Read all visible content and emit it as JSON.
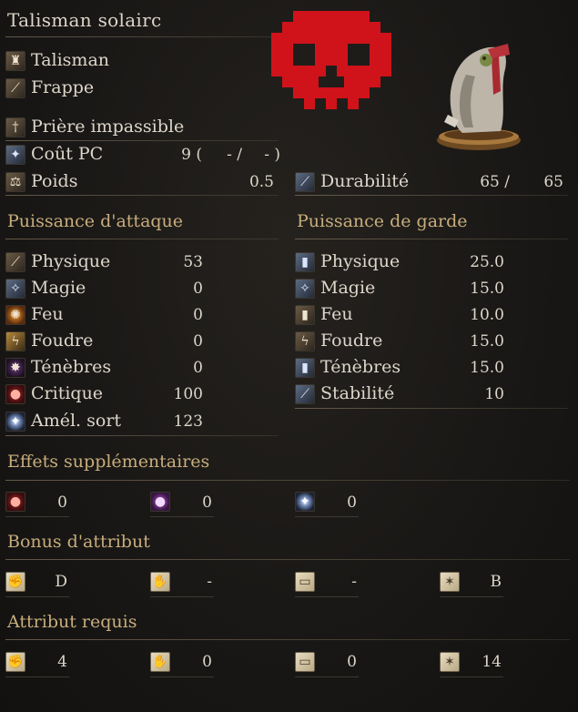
{
  "item": {
    "title": "Talisman solairc",
    "weapon_type": "Talisman",
    "attack_type": "Frappe",
    "skill": "Prière impassible"
  },
  "stats": {
    "fp_cost_label": "Coût PC",
    "fp_cost_value": "9 (",
    "fp_cost_sep": "- /",
    "fp_cost_end": "- )",
    "weight_label": "Poids",
    "weight_value": "0.5",
    "durability_label": "Durabilité",
    "durability_value": "65 /",
    "durability_max": "65"
  },
  "attack": {
    "heading": "Puissance d'attaque",
    "rows": [
      {
        "label": "Physique",
        "value": "53",
        "icon": "physical-attack-icon"
      },
      {
        "label": "Magie",
        "value": "0",
        "icon": "magic-attack-icon"
      },
      {
        "label": "Feu",
        "value": "0",
        "icon": "fire-attack-icon"
      },
      {
        "label": "Foudre",
        "value": "0",
        "icon": "lightning-attack-icon"
      },
      {
        "label": "Ténèbres",
        "value": "0",
        "icon": "dark-attack-icon"
      },
      {
        "label": "Critique",
        "value": "100",
        "icon": "critical-icon"
      },
      {
        "label": "Amél. sort",
        "value": "123",
        "icon": "spell-buff-icon"
      }
    ]
  },
  "guard": {
    "heading": "Puissance de garde",
    "rows": [
      {
        "label": "Physique",
        "value": "25.0",
        "icon": "physical-guard-icon"
      },
      {
        "label": "Magie",
        "value": "15.0",
        "icon": "magic-guard-icon"
      },
      {
        "label": "Feu",
        "value": "10.0",
        "icon": "fire-guard-icon"
      },
      {
        "label": "Foudre",
        "value": "15.0",
        "icon": "lightning-guard-icon"
      },
      {
        "label": "Ténèbres",
        "value": "15.0",
        "icon": "dark-guard-icon"
      },
      {
        "label": "Stabilité",
        "value": "10",
        "icon": "stability-icon"
      }
    ]
  },
  "effects": {
    "heading": "Effets supplémentaires",
    "items": [
      {
        "value": "0",
        "icon": "bleed-icon"
      },
      {
        "value": "0",
        "icon": "poison-icon"
      },
      {
        "value": "0",
        "icon": "frost-icon"
      }
    ]
  },
  "bonus": {
    "heading": "Bonus d'attribut",
    "items": [
      {
        "value": "D",
        "icon": "strength-icon"
      },
      {
        "value": "-",
        "icon": "dexterity-icon"
      },
      {
        "value": "-",
        "icon": "intelligence-icon"
      },
      {
        "value": "B",
        "icon": "faith-icon"
      }
    ]
  },
  "requirements": {
    "heading": "Attribut requis",
    "items": [
      {
        "value": "4",
        "icon": "strength-icon"
      },
      {
        "value": "0",
        "icon": "dexterity-icon"
      },
      {
        "value": "0",
        "icon": "intelligence-icon"
      },
      {
        "value": "14",
        "icon": "faith-icon"
      }
    ]
  },
  "colors": {
    "section_heading": "#c8ad7c",
    "skull_overlay": "#d0131a",
    "text": "#ddd6ca",
    "background": "#1a1816"
  }
}
